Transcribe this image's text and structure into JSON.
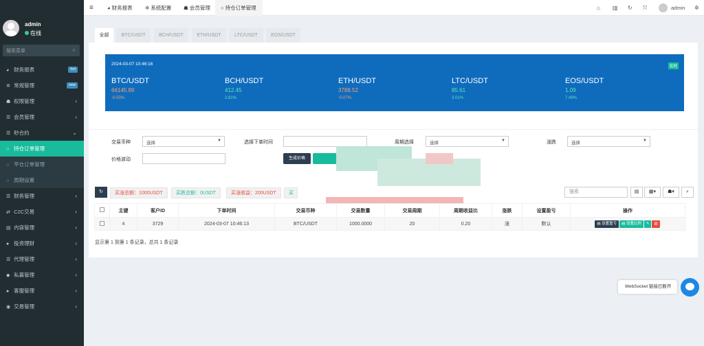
{
  "sidebar": {
    "user": {
      "name": "admin",
      "status": "在线"
    },
    "search_placeholder": "搜索菜单",
    "items": [
      {
        "label": "财务报表",
        "badge": "hot"
      },
      {
        "label": "常规管理",
        "badge": "new"
      },
      {
        "label": "权限管理",
        "arrow": "‹"
      },
      {
        "label": "会员管理",
        "arrow": "‹"
      },
      {
        "label": "秒合约",
        "arrow": "⌄"
      },
      {
        "label": "持仓订单管理"
      },
      {
        "label": "平仓订单管理"
      },
      {
        "label": "周期设置"
      },
      {
        "label": "财务管理",
        "arrow": "‹"
      },
      {
        "label": "C2C交易",
        "arrow": "‹"
      },
      {
        "label": "内容管理",
        "arrow": "‹"
      },
      {
        "label": "投资理财",
        "arrow": "‹"
      },
      {
        "label": "代理管理",
        "arrow": "‹"
      },
      {
        "label": "私募管理",
        "arrow": "‹"
      },
      {
        "label": "客服管理",
        "arrow": "‹"
      },
      {
        "label": "交易管理",
        "arrow": "‹"
      }
    ]
  },
  "topbar": {
    "menu_icon": "≡",
    "tabs": [
      "财务报表",
      "系统配置",
      "会员管理",
      "持仓订单管理"
    ],
    "user": "admin"
  },
  "tabs": [
    "全部",
    "BTC/USDT",
    "BCH/USDT",
    "ETH/USDT",
    "LTC/USDT",
    "EOS/USDT"
  ],
  "banner": {
    "date": "2024-03-07 10:46:16",
    "tag": "实时",
    "coins": [
      {
        "name": "BTC/USDT",
        "price": "66145.89",
        "change": "-0.50%",
        "trend": "down"
      },
      {
        "name": "BCH/USDT",
        "price": "412.45",
        "change": "2.81%",
        "trend": "up"
      },
      {
        "name": "ETH/USDT",
        "price": "3788.52",
        "change": "-0.07%",
        "trend": "down"
      },
      {
        "name": "LTC/USDT",
        "price": "85.61",
        "change": "3.01%",
        "trend": "up"
      },
      {
        "name": "EOS/USDT",
        "price": "1.09",
        "change": "7.49%",
        "trend": "up"
      }
    ]
  },
  "filters": {
    "coin_label": "交易币种",
    "coin_value": "选择",
    "time_label": "选择下单时间",
    "period_label": "周期选择",
    "period_value": "选择",
    "updown_label": "涨跌",
    "updown_value": "选择",
    "range_label": "价格波动",
    "generate_button": "生成价格"
  },
  "summary": {
    "buy_up_total": "买涨总额：1000USDT",
    "buy_down_total": "买跌总额：0USDT",
    "buy_up_profit": "买涨收益：200USDT",
    "more": "买"
  },
  "toolbar": {
    "search_placeholder": "搜索"
  },
  "table": {
    "headers": [
      "主键",
      "客户ID",
      "下单时间",
      "交易币种",
      "交易数量",
      "交易周期",
      "周期收益比",
      "涨跌",
      "设置盈亏",
      "操作"
    ],
    "rows": [
      {
        "id": "4",
        "client": "3729",
        "time": "2024-03-07 10:46:13",
        "coin": "BTC/USDT",
        "amount": "1000.0000",
        "period": "20",
        "ratio": "0.20",
        "updown": "涨",
        "setting": "默认"
      }
    ],
    "actions": [
      "设置盈亏",
      "设置比例"
    ]
  },
  "footer": "显示第 1 到第 1 条记录，总共 1 条记录",
  "websocket": "WebSocket 链接已断开",
  "colors": {
    "sidebar": "#222d32",
    "active": "#18bc9c",
    "banner": "#0f6cbd",
    "red": "#e74c3c",
    "green": "#18bc9c"
  }
}
